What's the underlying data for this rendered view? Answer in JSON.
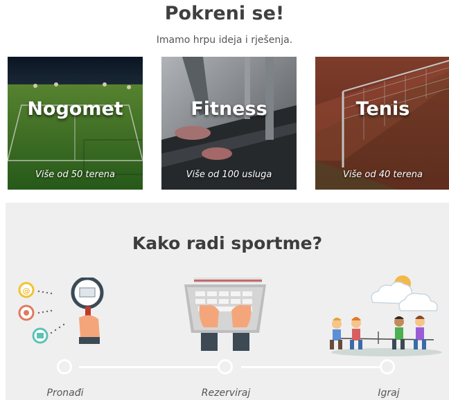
{
  "hero": {
    "title": "Pokreni se!",
    "subtitle": "Imamo hrpu ideja i rješenja."
  },
  "cards": [
    {
      "title": "Nogomet",
      "subtitle": "Više od 50 terena",
      "bg": "#2e5a1f"
    },
    {
      "title": "Fitness",
      "subtitle": "Više od 100 usluga",
      "bg": "#6a6a6a"
    },
    {
      "title": "Tenis",
      "subtitle": "Više od 40 terena",
      "bg": "#8a3f2c"
    }
  ],
  "how": {
    "title": "Kako radi sportme?",
    "steps": [
      {
        "label": "Pronađi",
        "icon": "search-illustration-icon"
      },
      {
        "label": "Rezerviraj",
        "icon": "laptop-illustration-icon"
      },
      {
        "label": "Igraj",
        "icon": "kids-playing-illustration-icon"
      }
    ]
  },
  "colors": {
    "section_bg": "#efefef",
    "title_text": "#3f3f3f",
    "accent_orange": "#f29b2e"
  }
}
